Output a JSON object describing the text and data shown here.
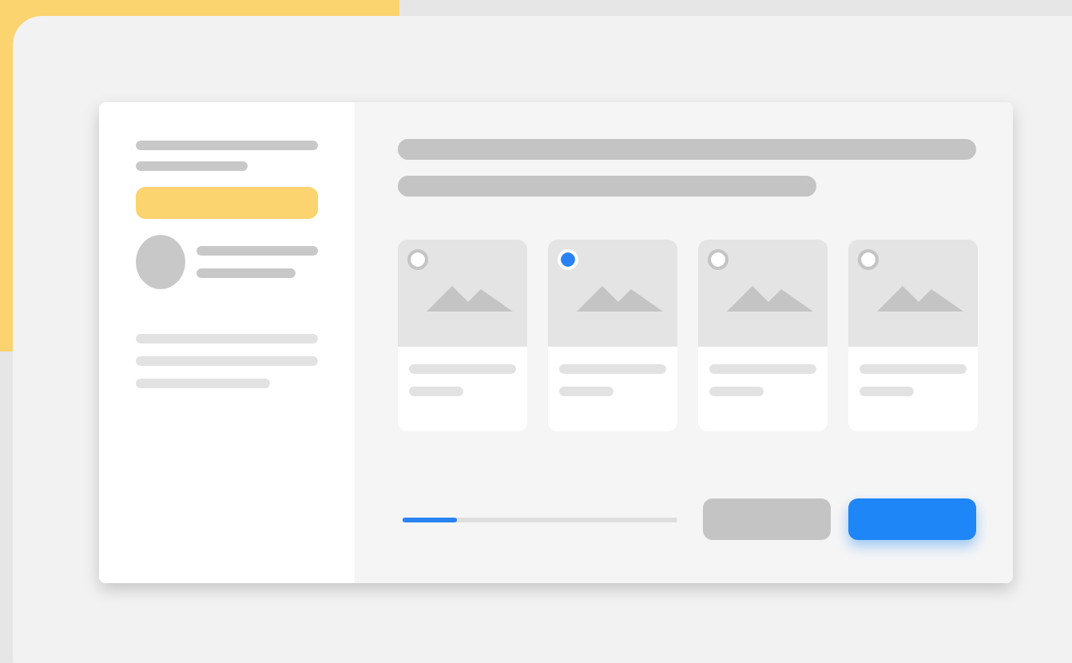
{
  "sidebar": {
    "highlighted": true
  },
  "cards": [
    {
      "selected": false
    },
    {
      "selected": true
    },
    {
      "selected": false
    },
    {
      "selected": false
    }
  ],
  "progress": {
    "level": 0.2
  },
  "buttons": [
    {
      "kind": "secondary"
    },
    {
      "kind": "primary"
    }
  ]
}
